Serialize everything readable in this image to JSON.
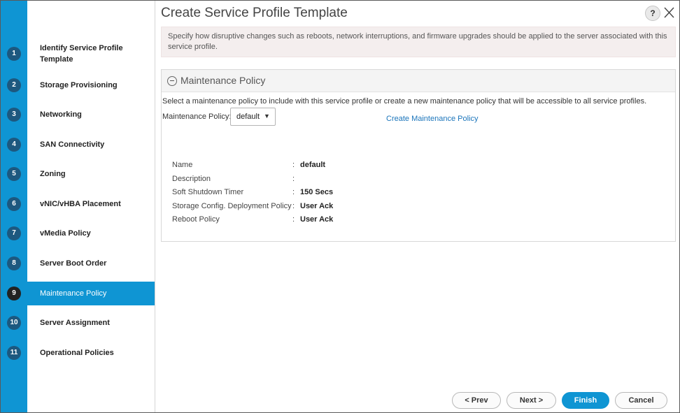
{
  "window": {
    "title": "Create Service Profile Template",
    "help_label": "?",
    "close_icon": "close-icon"
  },
  "steps": [
    {
      "num": "1",
      "label": "Identify Service Profile Template"
    },
    {
      "num": "2",
      "label": "Storage Provisioning"
    },
    {
      "num": "3",
      "label": "Networking"
    },
    {
      "num": "4",
      "label": "SAN Connectivity"
    },
    {
      "num": "5",
      "label": "Zoning"
    },
    {
      "num": "6",
      "label": "vNIC/vHBA Placement"
    },
    {
      "num": "7",
      "label": "vMedia Policy"
    },
    {
      "num": "8",
      "label": "Server Boot Order"
    },
    {
      "num": "9",
      "label": "Maintenance Policy",
      "active": true
    },
    {
      "num": "10",
      "label": "Server Assignment"
    },
    {
      "num": "11",
      "label": "Operational Policies"
    }
  ],
  "info_text": "Specify how disruptive changes such as reboots, network interruptions, and firmware upgrades should be applied to the server associated with this service profile.",
  "panel": {
    "title": "Maintenance Policy",
    "description": "Select a maintenance policy to include with this service profile or create a new maintenance policy that will be accessible to all service profiles.",
    "policy_label": "Maintenance Policy:",
    "policy_value": "default",
    "create_link": "Create Maintenance Policy",
    "properties": [
      {
        "name": "Name",
        "value": "default"
      },
      {
        "name": "Description",
        "value": ""
      },
      {
        "name": "Soft Shutdown Timer",
        "value": "150 Secs"
      },
      {
        "name": "Storage Config. Deployment Policy",
        "value": "User Ack"
      },
      {
        "name": "Reboot Policy",
        "value": "User Ack"
      }
    ]
  },
  "footer": {
    "prev": "< Prev",
    "next": "Next >",
    "finish": "Finish",
    "cancel": "Cancel"
  },
  "colors": {
    "accent": "#0f95d3",
    "step_circle": "#1d587f",
    "link": "#1b75bb"
  }
}
